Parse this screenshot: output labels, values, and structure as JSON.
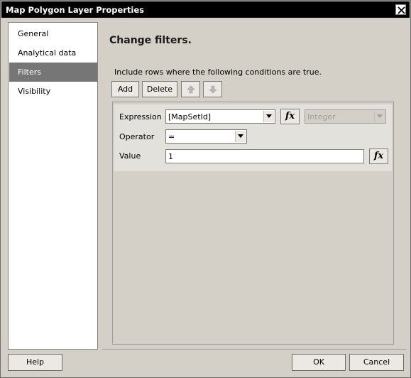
{
  "window": {
    "title": "Map Polygon Layer Properties"
  },
  "sidebar": {
    "items": [
      {
        "label": "General",
        "selected": false
      },
      {
        "label": "Analytical data",
        "selected": false
      },
      {
        "label": "Filters",
        "selected": true
      },
      {
        "label": "Visibility",
        "selected": false
      }
    ]
  },
  "main": {
    "title": "Change filters.",
    "instruction": "Include rows where the following conditions are true.",
    "toolbar": {
      "add_label": "Add",
      "delete_label": "Delete",
      "move_up_icon": "arrow-up-icon",
      "move_down_icon": "arrow-down-icon"
    },
    "filter": {
      "expression_label": "Expression",
      "expression_value": "[MapSetId]",
      "type_value": "Integer",
      "operator_label": "Operator",
      "operator_value": "=",
      "value_label": "Value",
      "value_value": "1",
      "fx_label": "fx"
    }
  },
  "footer": {
    "help_label": "Help",
    "ok_label": "OK",
    "cancel_label": "Cancel"
  }
}
